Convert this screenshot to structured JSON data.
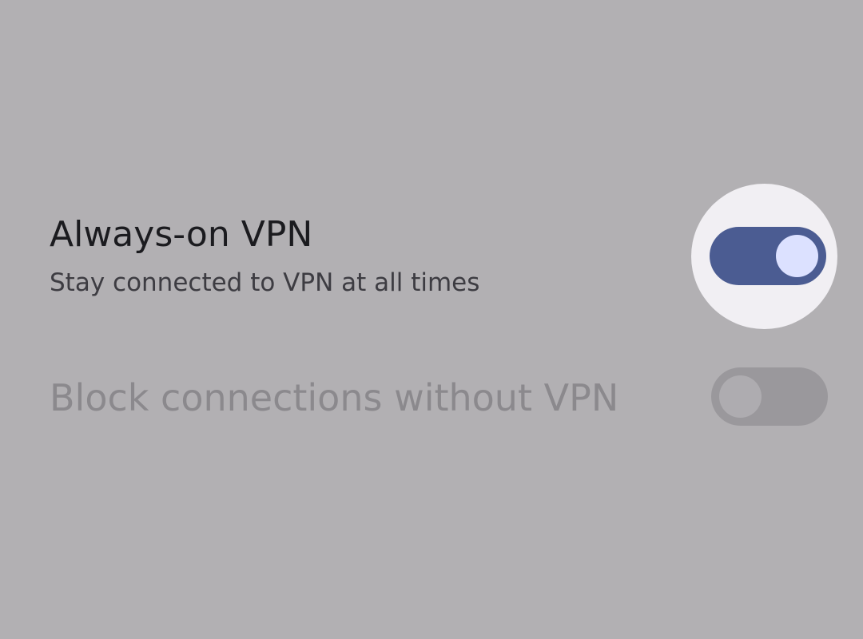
{
  "settings": {
    "always_on_vpn": {
      "title": "Always-on VPN",
      "summary": "Stay connected to VPN at all times",
      "enabled": true
    },
    "block_connections": {
      "title": "Block connections without VPN",
      "enabled": false,
      "disabled": true
    }
  },
  "colors": {
    "background": "#b2b0b3",
    "switch_on_track": "#4b5c92",
    "switch_on_thumb": "#dce1ff",
    "switch_off_track": "#9a989c",
    "switch_off_thumb": "#aeacb0",
    "focus_halo": "#f1eff3"
  }
}
